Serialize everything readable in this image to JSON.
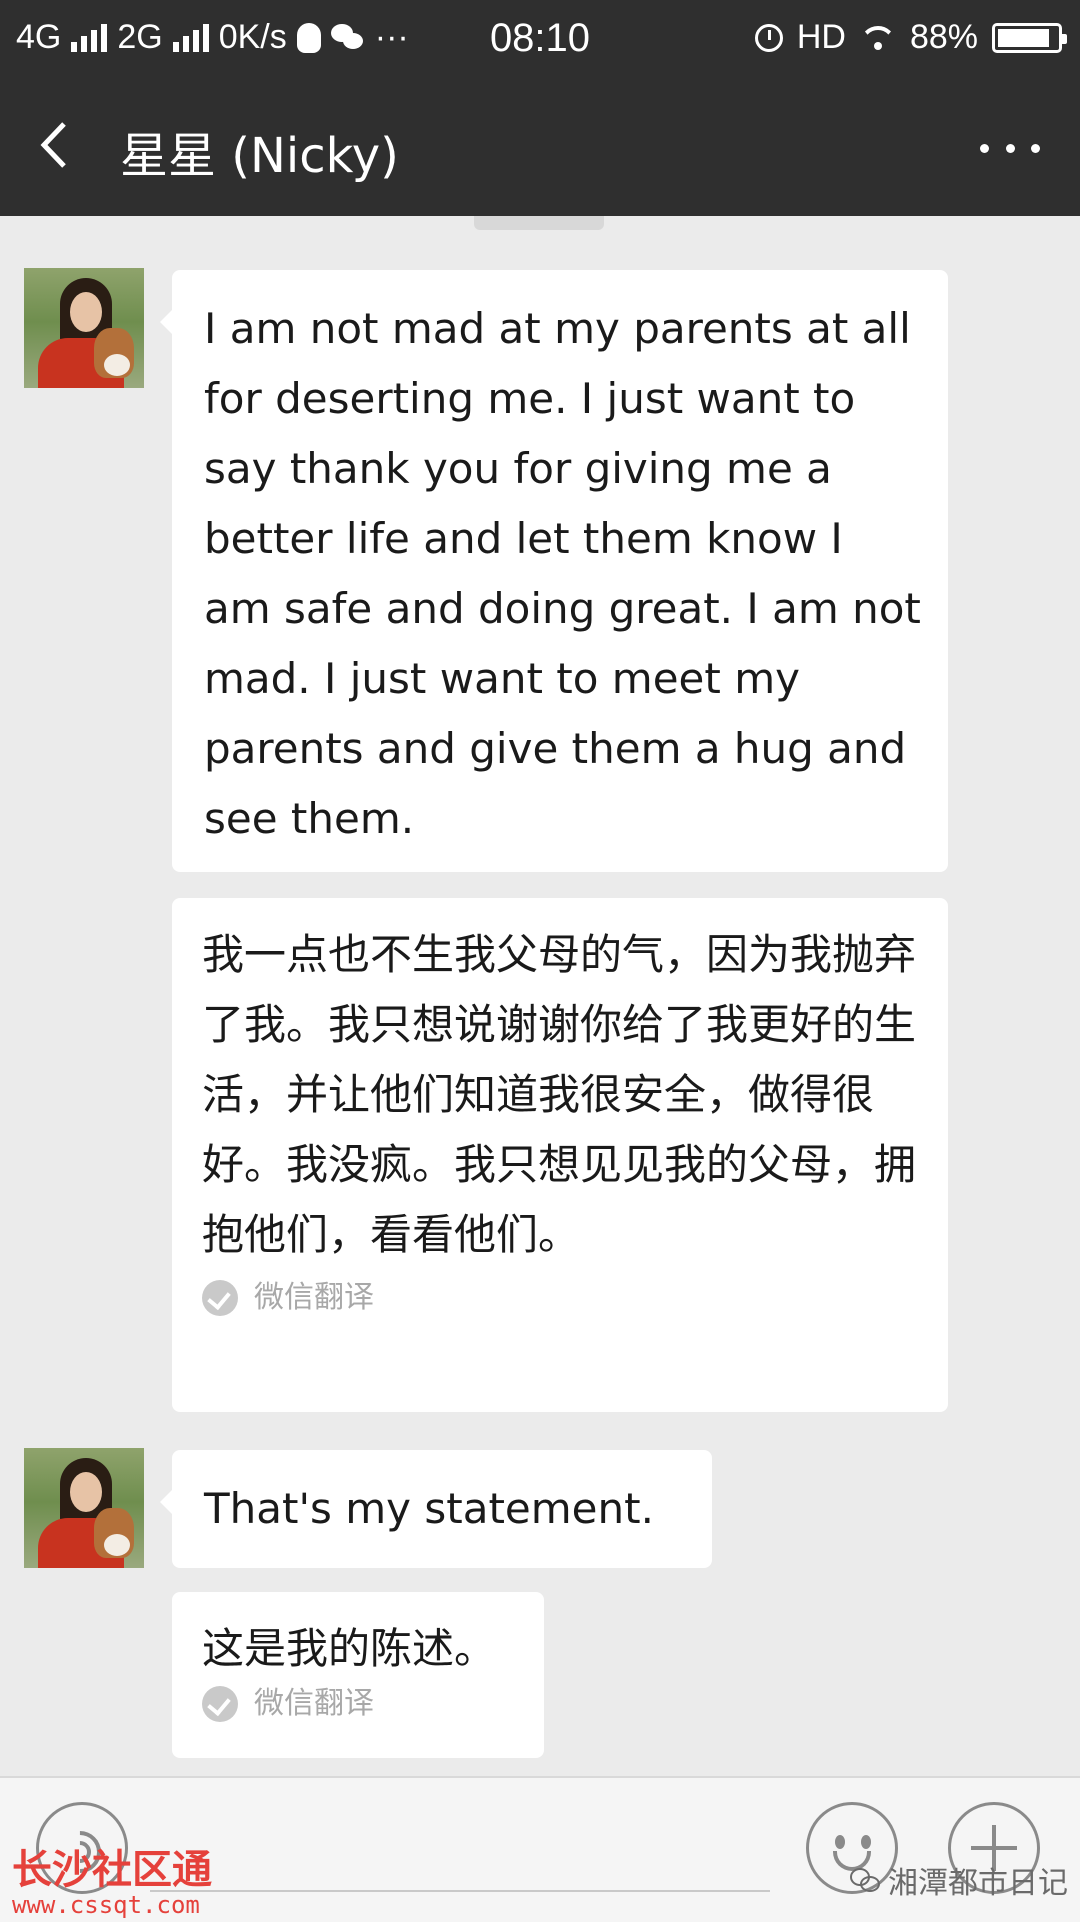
{
  "status_bar": {
    "network_1": "4G",
    "network_2": "2G",
    "speed": "0K/s",
    "more": "···",
    "time": "08:10",
    "hd": "HD",
    "battery_percent": "88%",
    "battery_level": 0.88
  },
  "header": {
    "title": "星星 (Nicky)"
  },
  "messages": [
    {
      "text": "I am not mad at my parents at all for deserting me.  I just want to say thank you for giving me a better life and let them know I am safe and doing great. I am not mad. I just want to meet my parents and give them a hug and see them.",
      "translation": "我一点也不生我父母的气，因为我抛弃了我。我只想说谢谢你给了我更好的生活，并让他们知道我很安全，做得很好。我没疯。我只想见见我的父母，拥抱他们，看看他们。",
      "translation_label": "微信翻译"
    },
    {
      "text": "That's my statement.",
      "translation": "这是我的陈述。",
      "translation_label": "微信翻译"
    }
  ],
  "watermarks": {
    "left_brand": "长沙社区通",
    "left_url": "www.cssqt.com",
    "right_brand": "湘潭都市日记"
  }
}
